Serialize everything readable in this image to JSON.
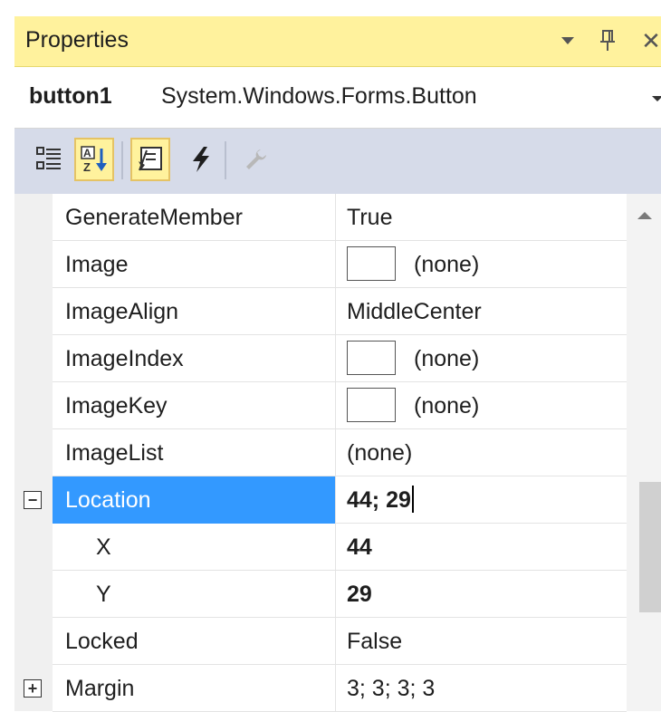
{
  "panel": {
    "title": "Properties",
    "close_glyph": "✕",
    "pin_glyph": "📌"
  },
  "object_selector": {
    "name": "button1",
    "type": "System.Windows.Forms.Button"
  },
  "toolbar": {
    "tools": [
      {
        "id": "categorized",
        "icon": "categorized-icon",
        "checked": false
      },
      {
        "id": "alphabetical",
        "icon": "alphabetical-icon",
        "checked": true
      },
      {
        "id": "properties",
        "icon": "properties-icon",
        "checked": true
      },
      {
        "id": "events",
        "icon": "lightning-icon",
        "checked": false
      },
      {
        "id": "property-pages",
        "icon": "wrench-icon",
        "checked": false
      }
    ]
  },
  "grid": {
    "rows": [
      {
        "name": "GenerateMember",
        "value": "True"
      },
      {
        "name": "Image",
        "value": "(none)",
        "swatch": true
      },
      {
        "name": "ImageAlign",
        "value": "MiddleCenter"
      },
      {
        "name": "ImageIndex",
        "value": "(none)",
        "swatch": true
      },
      {
        "name": "ImageKey",
        "value": "(none)",
        "swatch": true
      },
      {
        "name": "ImageList",
        "value": "(none)"
      },
      {
        "name": "Location",
        "value": "44; 29",
        "expander": "⊟",
        "selected": true,
        "bold": true,
        "editing": true
      },
      {
        "name": "X",
        "value": "44",
        "indent": true,
        "bold": true
      },
      {
        "name": "Y",
        "value": "29",
        "indent": true,
        "bold": true
      },
      {
        "name": "Locked",
        "value": "False"
      },
      {
        "name": "Margin",
        "value": "3; 3; 3; 3",
        "expander": "⊞"
      }
    ]
  },
  "colors": {
    "titlebar_bg": "#fff29d",
    "toolbar_bg": "#d6dbe9",
    "selection": "#3399ff"
  }
}
